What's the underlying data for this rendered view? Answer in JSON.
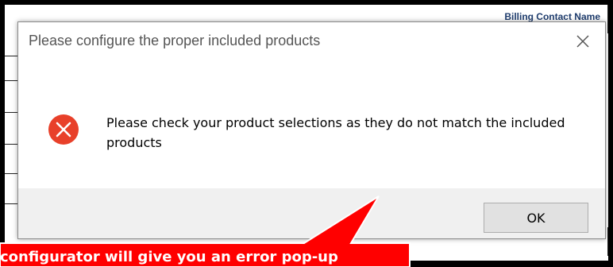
{
  "background": {
    "header_text": "Billing Contact Name"
  },
  "dialog": {
    "title": "Please configure the proper included products",
    "close_icon": "close-icon",
    "status_icon": "error-icon",
    "message": "Please check your product selections as they do not match the included products",
    "ok_label": "OK"
  },
  "callout": {
    "text": "configurator will give you an error pop-up",
    "color": "#ff0000"
  },
  "colors": {
    "error_red": "#e8402a",
    "button_bar": "#f0f0f0"
  }
}
